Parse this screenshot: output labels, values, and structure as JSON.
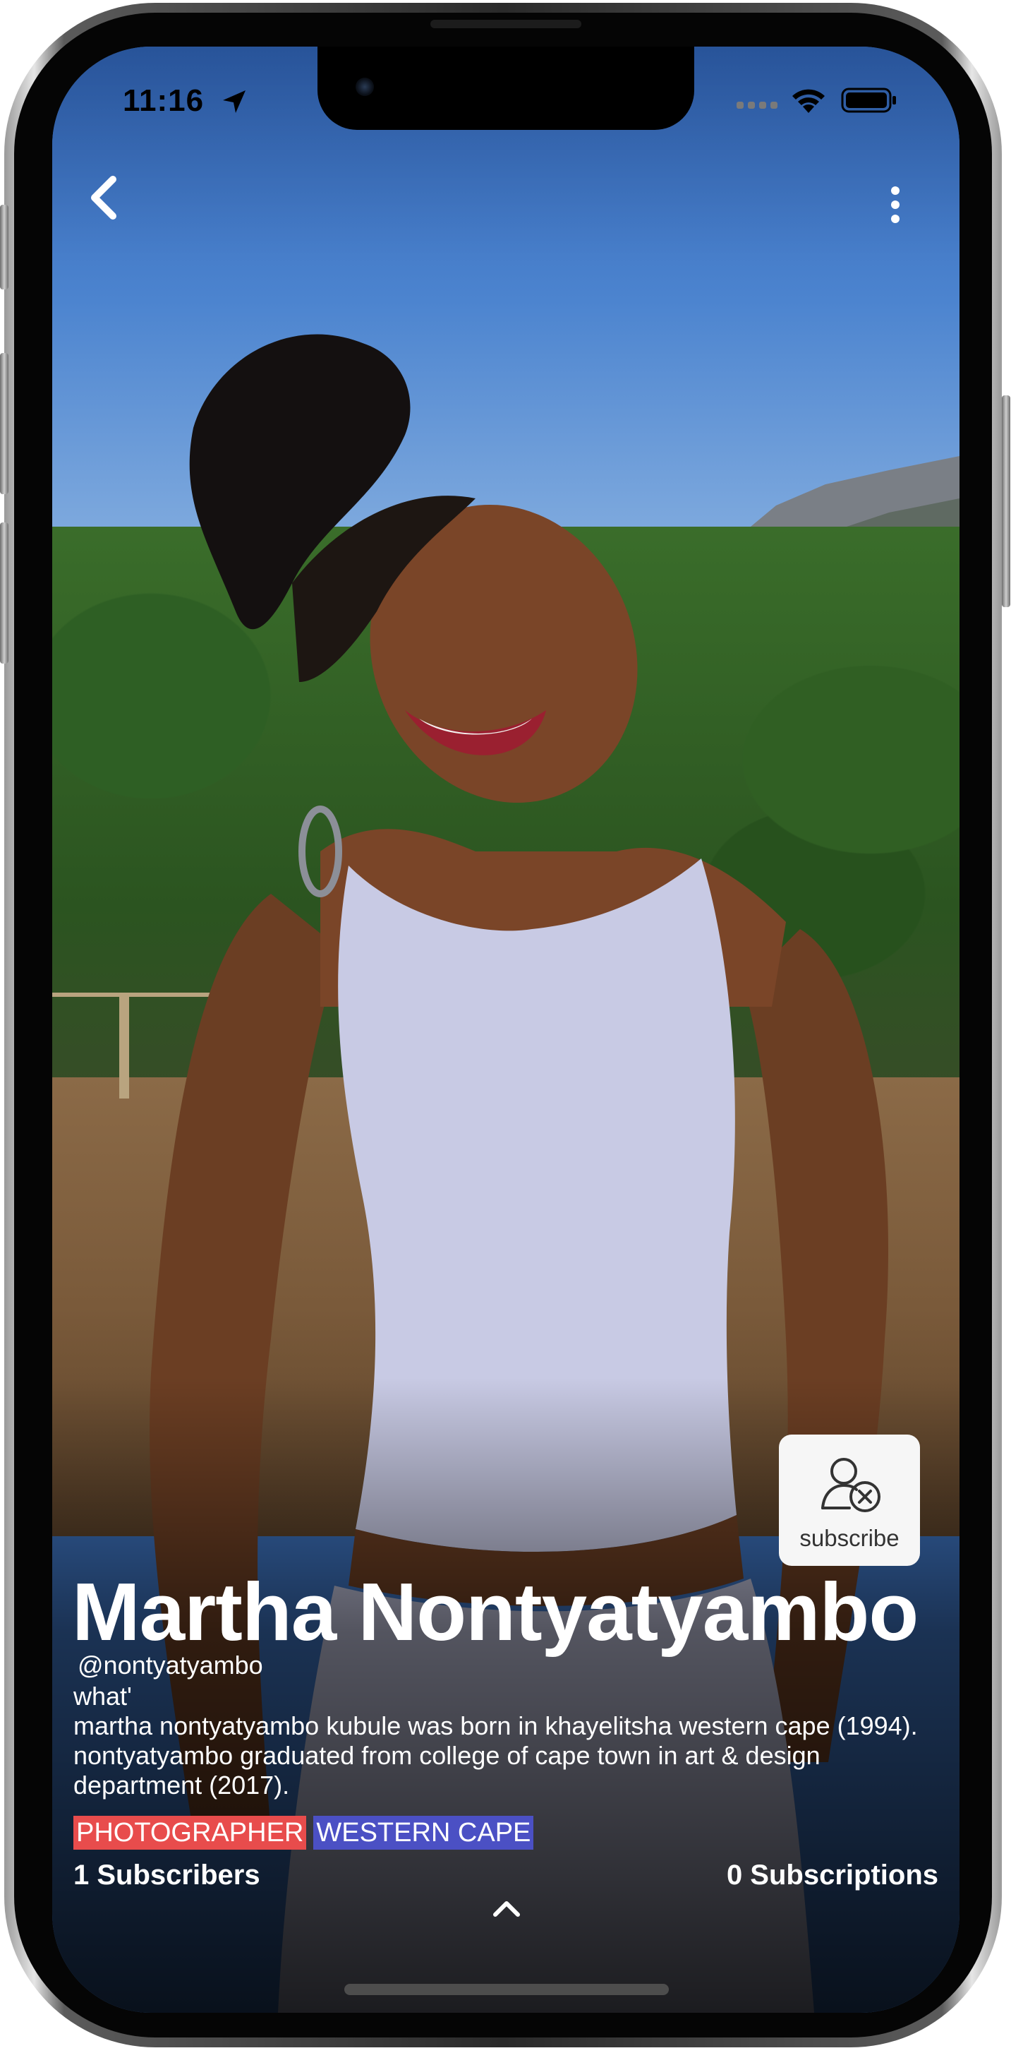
{
  "status_bar": {
    "time": "11:16"
  },
  "profile": {
    "name": "Martha Nontyatyambo",
    "handle": "@nontyatyambo",
    "what": "what'",
    "bio": "martha nontyatyambo kubule was born in khayelitsha western cape (1994). nontyatyambo graduated from college of cape town in art & design department (2017).",
    "tags": [
      {
        "label": "PHOTOGRAPHER",
        "color": "#e84c4c"
      },
      {
        "label": "WESTERN CAPE",
        "color": "#4b50c4"
      }
    ],
    "subscribers_label": "1  Subscribers",
    "subscriptions_label": "0 Subscriptions"
  },
  "subscribe_button": {
    "label": "subscribe",
    "icon": "user-remove-icon"
  },
  "icons": {
    "back": "back-chevron-icon",
    "more": "more-vertical-icon",
    "expand": "chevron-up-icon"
  }
}
